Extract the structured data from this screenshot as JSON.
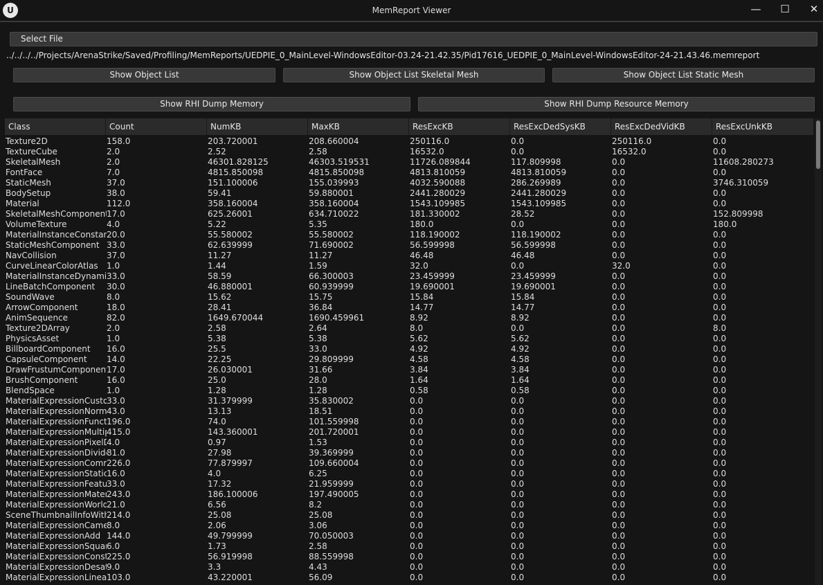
{
  "window": {
    "title": "MemReport Viewer",
    "logo": "U",
    "minimize": "—",
    "maximize": "☐",
    "close": "✕"
  },
  "toolbar": {
    "select_file": "Select File",
    "path": "../../../../Projects/ArenaStrike/Saved/Profiling/MemReports/UEDPIE_0_MainLevel-WindowsEditor-03.24-21.42.35/Pid17616_UEDPIE_0_MainLevel-WindowsEditor-24-21.43.46.memreport",
    "show_object_list": "Show Object List",
    "show_object_list_skeletal": "Show Object List Skeletal Mesh",
    "show_object_list_static": "Show Object List Static Mesh",
    "show_rhi_dump": "Show RHI Dump Memory",
    "show_rhi_dump_resource": "Show RHI Dump Resource Memory"
  },
  "table": {
    "headers": [
      "Class",
      "Count",
      "NumKB",
      "MaxKB",
      "ResExcKB",
      "ResExcDedSysKB",
      "ResExcDedVidKB",
      "ResExcUnkKB"
    ],
    "rows": [
      [
        "Texture2D",
        "158.0",
        "203.720001",
        "208.660004",
        "250116.0",
        "0.0",
        "250116.0",
        "0.0"
      ],
      [
        "TextureCube",
        "2.0",
        "2.52",
        "2.58",
        "16532.0",
        "0.0",
        "16532.0",
        "0.0"
      ],
      [
        "SkeletalMesh",
        "2.0",
        "46301.828125",
        "46303.519531",
        "11726.089844",
        "117.809998",
        "0.0",
        "11608.280273"
      ],
      [
        "FontFace",
        "7.0",
        "4815.850098",
        "4815.850098",
        "4813.810059",
        "4813.810059",
        "0.0",
        "0.0"
      ],
      [
        "StaticMesh",
        "37.0",
        "151.100006",
        "155.039993",
        "4032.590088",
        "286.269989",
        "0.0",
        "3746.310059"
      ],
      [
        "BodySetup",
        "38.0",
        "59.41",
        "59.880001",
        "2441.280029",
        "2441.280029",
        "0.0",
        "0.0"
      ],
      [
        "Material",
        "112.0",
        "358.160004",
        "358.160004",
        "1543.109985",
        "1543.109985",
        "0.0",
        "0.0"
      ],
      [
        "SkeletalMeshComponent",
        "17.0",
        "625.26001",
        "634.710022",
        "181.330002",
        "28.52",
        "0.0",
        "152.809998"
      ],
      [
        "VolumeTexture",
        "4.0",
        "5.22",
        "5.35",
        "180.0",
        "0.0",
        "0.0",
        "180.0"
      ],
      [
        "MaterialInstanceConstant",
        "20.0",
        "55.580002",
        "55.580002",
        "118.190002",
        "118.190002",
        "0.0",
        "0.0"
      ],
      [
        "StaticMeshComponent",
        "33.0",
        "62.639999",
        "71.690002",
        "56.599998",
        "56.599998",
        "0.0",
        "0.0"
      ],
      [
        "NavCollision",
        "37.0",
        "11.27",
        "11.27",
        "46.48",
        "46.48",
        "0.0",
        "0.0"
      ],
      [
        "CurveLinearColorAtlas",
        "1.0",
        "1.44",
        "1.59",
        "32.0",
        "0.0",
        "32.0",
        "0.0"
      ],
      [
        "MaterialInstanceDynamic",
        "33.0",
        "58.59",
        "66.300003",
        "23.459999",
        "23.459999",
        "0.0",
        "0.0"
      ],
      [
        "LineBatchComponent",
        "30.0",
        "46.880001",
        "60.939999",
        "19.690001",
        "19.690001",
        "0.0",
        "0.0"
      ],
      [
        "SoundWave",
        "8.0",
        "15.62",
        "15.75",
        "15.84",
        "15.84",
        "0.0",
        "0.0"
      ],
      [
        "ArrowComponent",
        "18.0",
        "28.41",
        "36.84",
        "14.77",
        "14.77",
        "0.0",
        "0.0"
      ],
      [
        "AnimSequence",
        "82.0",
        "1649.670044",
        "1690.459961",
        "8.92",
        "8.92",
        "0.0",
        "0.0"
      ],
      [
        "Texture2DArray",
        "2.0",
        "2.58",
        "2.64",
        "8.0",
        "0.0",
        "0.0",
        "8.0"
      ],
      [
        "PhysicsAsset",
        "1.0",
        "5.38",
        "5.38",
        "5.62",
        "5.62",
        "0.0",
        "0.0"
      ],
      [
        "BillboardComponent",
        "16.0",
        "25.5",
        "33.0",
        "4.92",
        "4.92",
        "0.0",
        "0.0"
      ],
      [
        "CapsuleComponent",
        "14.0",
        "22.25",
        "29.809999",
        "4.58",
        "4.58",
        "0.0",
        "0.0"
      ],
      [
        "DrawFrustumComponent",
        "17.0",
        "26.030001",
        "31.66",
        "3.84",
        "3.84",
        "0.0",
        "0.0"
      ],
      [
        "BrushComponent",
        "16.0",
        "25.0",
        "28.0",
        "1.64",
        "1.64",
        "0.0",
        "0.0"
      ],
      [
        "BlendSpace",
        "1.0",
        "1.28",
        "1.28",
        "0.58",
        "0.58",
        "0.0",
        "0.0"
      ],
      [
        "MaterialExpressionCustom",
        "33.0",
        "31.379999",
        "35.830002",
        "0.0",
        "0.0",
        "0.0",
        "0.0"
      ],
      [
        "MaterialExpressionNormalize",
        "43.0",
        "13.13",
        "18.51",
        "0.0",
        "0.0",
        "0.0",
        "0.0"
      ],
      [
        "MaterialExpressionFunctionCall",
        "196.0",
        "74.0",
        "101.559998",
        "0.0",
        "0.0",
        "0.0",
        "0.0"
      ],
      [
        "MaterialExpressionMultiply",
        "415.0",
        "143.360001",
        "201.720001",
        "0.0",
        "0.0",
        "0.0",
        "0.0"
      ],
      [
        "MaterialExpressionPixelDepth",
        "4.0",
        "0.97",
        "1.53",
        "0.0",
        "0.0",
        "0.0",
        "0.0"
      ],
      [
        "MaterialExpressionDivide",
        "81.0",
        "27.98",
        "39.369999",
        "0.0",
        "0.0",
        "0.0",
        "0.0"
      ],
      [
        "MaterialExpressionComment",
        "226.0",
        "77.879997",
        "109.660004",
        "0.0",
        "0.0",
        "0.0",
        "0.0"
      ],
      [
        "MaterialExpressionStaticBool",
        "16.0",
        "4.0",
        "6.25",
        "0.0",
        "0.0",
        "0.0",
        "0.0"
      ],
      [
        "MaterialExpressionFeatureLevelSwitch",
        "33.0",
        "17.32",
        "21.959999",
        "0.0",
        "0.0",
        "0.0",
        "0.0"
      ],
      [
        "MaterialExpressionMaterialFunctionCall",
        "243.0",
        "186.100006",
        "197.490005",
        "0.0",
        "0.0",
        "0.0",
        "0.0"
      ],
      [
        "MaterialExpressionWorldPosition",
        "21.0",
        "6.56",
        "8.2",
        "0.0",
        "0.0",
        "0.0",
        "0.0"
      ],
      [
        "SceneThumbnailInfoWithPrimitive",
        "214.0",
        "25.08",
        "25.08",
        "0.0",
        "0.0",
        "0.0",
        "0.0"
      ],
      [
        "MaterialExpressionCameraPositionWS",
        "8.0",
        "2.06",
        "3.06",
        "0.0",
        "0.0",
        "0.0",
        "0.0"
      ],
      [
        "MaterialExpressionAdd",
        "144.0",
        "49.799999",
        "70.050003",
        "0.0",
        "0.0",
        "0.0",
        "0.0"
      ],
      [
        "MaterialExpressionSquareRoot",
        "6.0",
        "1.73",
        "2.58",
        "0.0",
        "0.0",
        "0.0",
        "0.0"
      ],
      [
        "MaterialExpressionConstant",
        "225.0",
        "56.919998",
        "88.559998",
        "0.0",
        "0.0",
        "0.0",
        "0.0"
      ],
      [
        "MaterialExpressionDesaturation",
        "9.0",
        "3.3",
        "4.43",
        "0.0",
        "0.0",
        "0.0",
        "0.0"
      ],
      [
        "MaterialExpressionLinearInterpolate",
        "103.0",
        "43.220001",
        "56.09",
        "0.0",
        "0.0",
        "0.0",
        "0.0"
      ]
    ]
  }
}
